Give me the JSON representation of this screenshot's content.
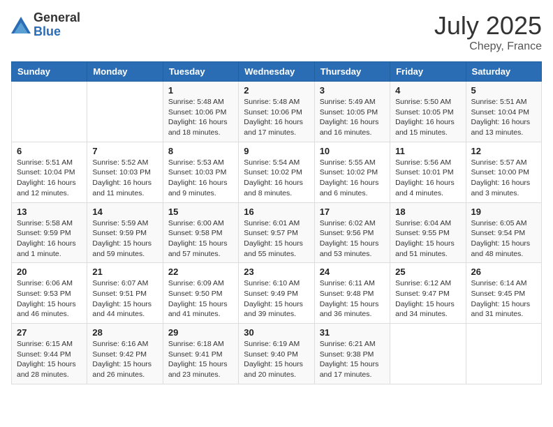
{
  "header": {
    "logo_general": "General",
    "logo_blue": "Blue",
    "month": "July 2025",
    "location": "Chepy, France"
  },
  "days_of_week": [
    "Sunday",
    "Monday",
    "Tuesday",
    "Wednesday",
    "Thursday",
    "Friday",
    "Saturday"
  ],
  "weeks": [
    [
      {
        "num": "",
        "detail": ""
      },
      {
        "num": "",
        "detail": ""
      },
      {
        "num": "1",
        "detail": "Sunrise: 5:48 AM\nSunset: 10:06 PM\nDaylight: 16 hours\nand 18 minutes."
      },
      {
        "num": "2",
        "detail": "Sunrise: 5:48 AM\nSunset: 10:06 PM\nDaylight: 16 hours\nand 17 minutes."
      },
      {
        "num": "3",
        "detail": "Sunrise: 5:49 AM\nSunset: 10:05 PM\nDaylight: 16 hours\nand 16 minutes."
      },
      {
        "num": "4",
        "detail": "Sunrise: 5:50 AM\nSunset: 10:05 PM\nDaylight: 16 hours\nand 15 minutes."
      },
      {
        "num": "5",
        "detail": "Sunrise: 5:51 AM\nSunset: 10:04 PM\nDaylight: 16 hours\nand 13 minutes."
      }
    ],
    [
      {
        "num": "6",
        "detail": "Sunrise: 5:51 AM\nSunset: 10:04 PM\nDaylight: 16 hours\nand 12 minutes."
      },
      {
        "num": "7",
        "detail": "Sunrise: 5:52 AM\nSunset: 10:03 PM\nDaylight: 16 hours\nand 11 minutes."
      },
      {
        "num": "8",
        "detail": "Sunrise: 5:53 AM\nSunset: 10:03 PM\nDaylight: 16 hours\nand 9 minutes."
      },
      {
        "num": "9",
        "detail": "Sunrise: 5:54 AM\nSunset: 10:02 PM\nDaylight: 16 hours\nand 8 minutes."
      },
      {
        "num": "10",
        "detail": "Sunrise: 5:55 AM\nSunset: 10:02 PM\nDaylight: 16 hours\nand 6 minutes."
      },
      {
        "num": "11",
        "detail": "Sunrise: 5:56 AM\nSunset: 10:01 PM\nDaylight: 16 hours\nand 4 minutes."
      },
      {
        "num": "12",
        "detail": "Sunrise: 5:57 AM\nSunset: 10:00 PM\nDaylight: 16 hours\nand 3 minutes."
      }
    ],
    [
      {
        "num": "13",
        "detail": "Sunrise: 5:58 AM\nSunset: 9:59 PM\nDaylight: 16 hours\nand 1 minute."
      },
      {
        "num": "14",
        "detail": "Sunrise: 5:59 AM\nSunset: 9:59 PM\nDaylight: 15 hours\nand 59 minutes."
      },
      {
        "num": "15",
        "detail": "Sunrise: 6:00 AM\nSunset: 9:58 PM\nDaylight: 15 hours\nand 57 minutes."
      },
      {
        "num": "16",
        "detail": "Sunrise: 6:01 AM\nSunset: 9:57 PM\nDaylight: 15 hours\nand 55 minutes."
      },
      {
        "num": "17",
        "detail": "Sunrise: 6:02 AM\nSunset: 9:56 PM\nDaylight: 15 hours\nand 53 minutes."
      },
      {
        "num": "18",
        "detail": "Sunrise: 6:04 AM\nSunset: 9:55 PM\nDaylight: 15 hours\nand 51 minutes."
      },
      {
        "num": "19",
        "detail": "Sunrise: 6:05 AM\nSunset: 9:54 PM\nDaylight: 15 hours\nand 48 minutes."
      }
    ],
    [
      {
        "num": "20",
        "detail": "Sunrise: 6:06 AM\nSunset: 9:53 PM\nDaylight: 15 hours\nand 46 minutes."
      },
      {
        "num": "21",
        "detail": "Sunrise: 6:07 AM\nSunset: 9:51 PM\nDaylight: 15 hours\nand 44 minutes."
      },
      {
        "num": "22",
        "detail": "Sunrise: 6:09 AM\nSunset: 9:50 PM\nDaylight: 15 hours\nand 41 minutes."
      },
      {
        "num": "23",
        "detail": "Sunrise: 6:10 AM\nSunset: 9:49 PM\nDaylight: 15 hours\nand 39 minutes."
      },
      {
        "num": "24",
        "detail": "Sunrise: 6:11 AM\nSunset: 9:48 PM\nDaylight: 15 hours\nand 36 minutes."
      },
      {
        "num": "25",
        "detail": "Sunrise: 6:12 AM\nSunset: 9:47 PM\nDaylight: 15 hours\nand 34 minutes."
      },
      {
        "num": "26",
        "detail": "Sunrise: 6:14 AM\nSunset: 9:45 PM\nDaylight: 15 hours\nand 31 minutes."
      }
    ],
    [
      {
        "num": "27",
        "detail": "Sunrise: 6:15 AM\nSunset: 9:44 PM\nDaylight: 15 hours\nand 28 minutes."
      },
      {
        "num": "28",
        "detail": "Sunrise: 6:16 AM\nSunset: 9:42 PM\nDaylight: 15 hours\nand 26 minutes."
      },
      {
        "num": "29",
        "detail": "Sunrise: 6:18 AM\nSunset: 9:41 PM\nDaylight: 15 hours\nand 23 minutes."
      },
      {
        "num": "30",
        "detail": "Sunrise: 6:19 AM\nSunset: 9:40 PM\nDaylight: 15 hours\nand 20 minutes."
      },
      {
        "num": "31",
        "detail": "Sunrise: 6:21 AM\nSunset: 9:38 PM\nDaylight: 15 hours\nand 17 minutes."
      },
      {
        "num": "",
        "detail": ""
      },
      {
        "num": "",
        "detail": ""
      }
    ]
  ]
}
